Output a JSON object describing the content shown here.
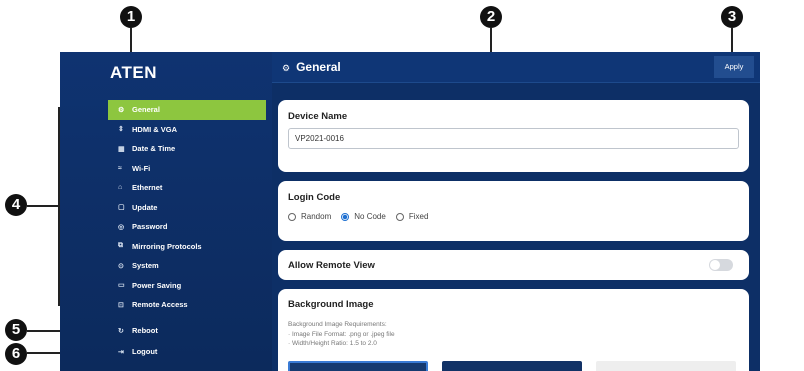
{
  "callouts": [
    "1",
    "2",
    "3",
    "4",
    "5",
    "6"
  ],
  "brand": "ATEN",
  "header": {
    "title": "General",
    "apply_label": "Apply"
  },
  "sidebar": {
    "items": [
      {
        "label": "General",
        "icon": "gear-icon",
        "active": true
      },
      {
        "label": "HDMI & VGA",
        "icon": "hdmi-icon"
      },
      {
        "label": "Date & Time",
        "icon": "calendar-icon"
      },
      {
        "label": "Wi-Fi",
        "icon": "wifi-icon"
      },
      {
        "label": "Ethernet",
        "icon": "ethernet-icon"
      },
      {
        "label": "Update",
        "icon": "update-icon"
      },
      {
        "label": "Password",
        "icon": "lock-icon"
      },
      {
        "label": "Mirroring Protocols",
        "icon": "mirroring-icon"
      },
      {
        "label": "System",
        "icon": "system-icon"
      },
      {
        "label": "Power Saving",
        "icon": "battery-icon"
      },
      {
        "label": "Remote Access",
        "icon": "remote-icon"
      }
    ],
    "bottom": [
      {
        "label": "Reboot",
        "icon": "reboot-icon"
      },
      {
        "label": "Logout",
        "icon": "logout-icon"
      }
    ]
  },
  "device_name": {
    "title": "Device Name",
    "value": "VP2021-0016"
  },
  "login_code": {
    "title": "Login Code",
    "options": [
      "Random",
      "No Code",
      "Fixed"
    ],
    "selected": "No Code"
  },
  "remote_view": {
    "title": "Allow Remote View",
    "enabled": false
  },
  "background": {
    "title": "Background Image",
    "requirements_title": "Background Image Requirements:",
    "requirements": [
      "· Image File Format: .png or .jpeg file",
      "· Width/Height Ratio: 1.5 to 2.0"
    ]
  },
  "colors": {
    "sidebar": "#0f3371",
    "active": "#8dc63f",
    "content_bg": "#0d2f66"
  }
}
